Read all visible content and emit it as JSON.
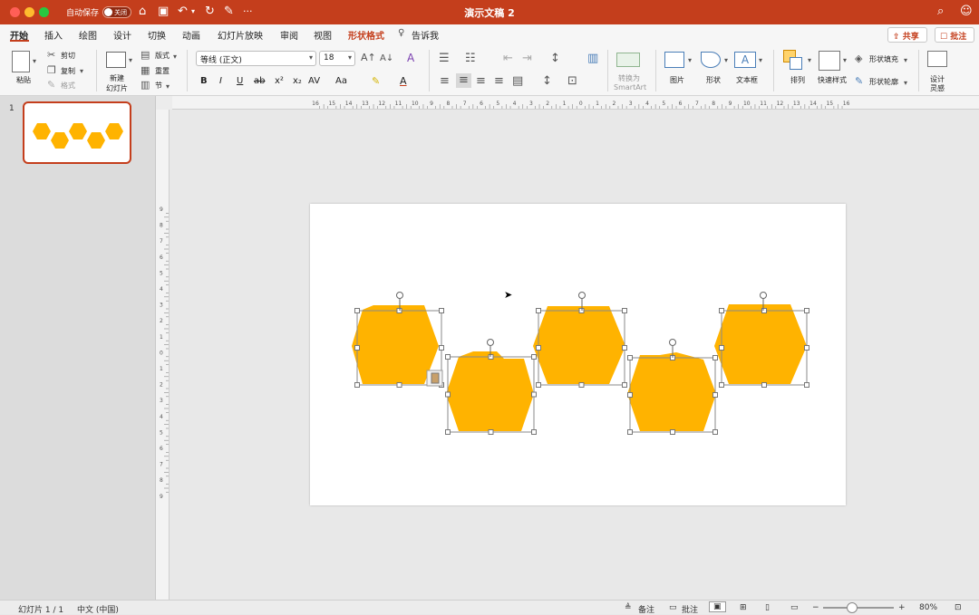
{
  "titlebar": {
    "autosave_label": "自动保存",
    "autosave_state": "关闭",
    "more": "···",
    "doc_title": "演示文稿 2"
  },
  "tabs": [
    "开始",
    "插入",
    "绘图",
    "设计",
    "切换",
    "动画",
    "幻灯片放映",
    "审阅",
    "视图",
    "形状格式",
    "告诉我"
  ],
  "top_buttons": {
    "share": "共享",
    "comments": "批注"
  },
  "ribbon": {
    "paste": "粘贴",
    "cut": "剪切",
    "copy": "复制",
    "format": "格式",
    "new_slide_l1": "新建",
    "new_slide_l2": "幻灯片",
    "layout": "版式",
    "reset": "重置",
    "section": "节",
    "font_name": "等线 (正文)",
    "font_size": "18",
    "convert_l1": "转换为",
    "convert_l2": "SmartArt",
    "picture": "图片",
    "shape": "形状",
    "textbox": "文本框",
    "arrange": "排列",
    "quick_styles": "快速样式",
    "shape_fill": "形状填充",
    "shape_outline": "形状轮廓",
    "designer_l1": "设计",
    "designer_l2": "灵感"
  },
  "thumbnail": {
    "number": "1"
  },
  "ruler_h_labels": [
    "16",
    "15",
    "14",
    "13",
    "12",
    "11",
    "10",
    "9",
    "8",
    "7",
    "6",
    "5",
    "4",
    "3",
    "2",
    "1",
    "0",
    "1",
    "2",
    "3",
    "4",
    "5",
    "6",
    "7",
    "8",
    "9",
    "10",
    "11",
    "12",
    "13",
    "14",
    "15",
    "16"
  ],
  "ruler_v_labels": [
    "9",
    "8",
    "7",
    "6",
    "5",
    "4",
    "3",
    "2",
    "1",
    "0",
    "1",
    "2",
    "3",
    "4",
    "5",
    "6",
    "7",
    "8",
    "9"
  ],
  "status": {
    "slide_count": "幻灯片 1 / 1",
    "language": "中文 (中国)",
    "notes": "备注",
    "comments": "批注",
    "zoom": "80%"
  },
  "colors": {
    "accent": "#c43e1c",
    "hexagon": "#ffb300"
  }
}
